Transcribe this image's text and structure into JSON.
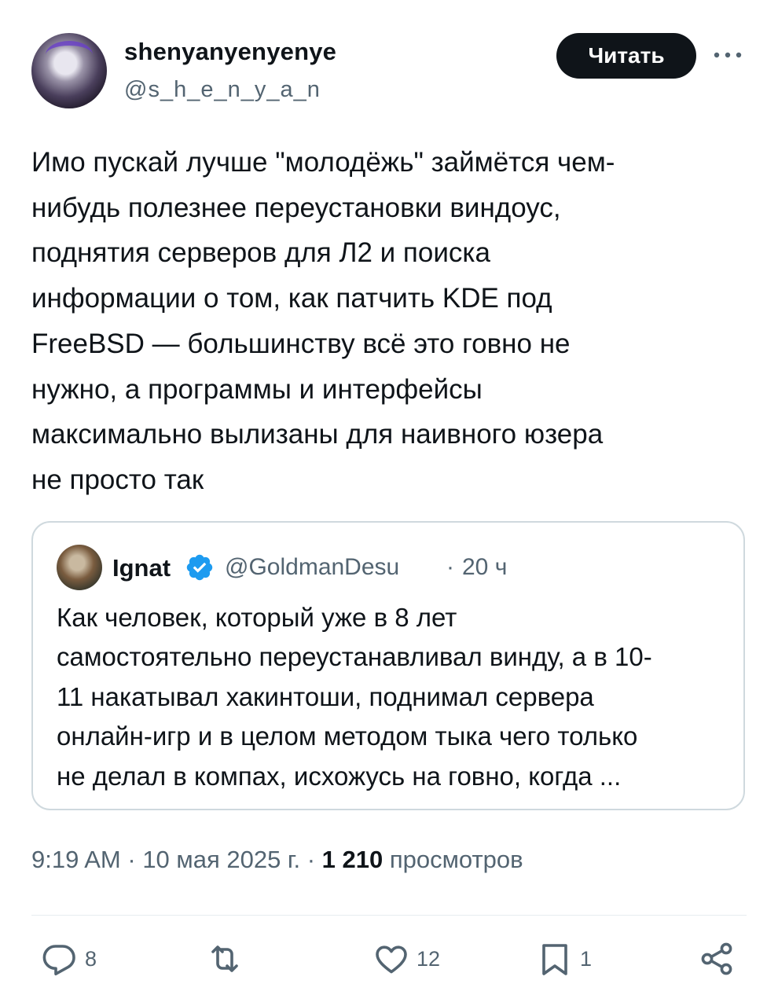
{
  "author": {
    "display_name": "shenyanyenyenye",
    "handle": "@s_h_e_n_y_a_n"
  },
  "follow_button_label": "Читать",
  "tweet_text": "Имо пускай лучше \"молодёжь\" займётся чем-\nнибудь полезнее переустановки виндоус,\nподнятия серверов для Л2 и поиска\nинформации о том, как патчить KDE под\nFreeBSD — большинству всё это говно не\nнужно, а программы и интерфейсы\nмаксимально вылизаны для наивного юзера\nне просто так",
  "quote": {
    "display_name": "Ignat",
    "handle": "@GoldmanDesu",
    "separator": "·",
    "time": "20 ч",
    "text": "Как человек, который уже в 8 лет\nсамостоятельно переустанавливал винду, а в 10-\n11 накатывал хакинтоши, поднимал сервера\nонлайн-игр и в целом методом тыка чего только\nне делал в компах, исхожусь на говно, когда ..."
  },
  "meta": {
    "time": "9:19 AM",
    "sep1": " · ",
    "date": "10 мая 2025 г.",
    "sep2": " · ",
    "views_count": "1 210",
    "views_label": " просмотров"
  },
  "actions": {
    "replies": "8",
    "likes": "12",
    "bookmarks": "1"
  },
  "colors": {
    "text": "#0f1419",
    "secondary": "#536471",
    "border": "#cfd9de",
    "verified": "#1d9bf0"
  }
}
